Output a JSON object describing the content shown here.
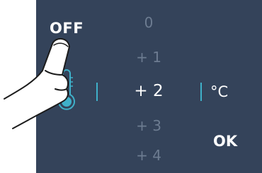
{
  "control": {
    "off_label": "OFF",
    "ok_label": "OK",
    "unit": "°C",
    "options": [
      "0",
      "+ 1",
      "+ 2",
      "+ 3",
      "+ 4"
    ],
    "selected": "+ 2"
  },
  "icons": {
    "thermometer": "thermometer-icon",
    "pointer": "pointing-hand-icon"
  },
  "colors": {
    "panel_bg": "#34435a",
    "accent": "#3fb0c9",
    "text_active": "#ffffff",
    "text_inactive": "#6d7c91"
  }
}
